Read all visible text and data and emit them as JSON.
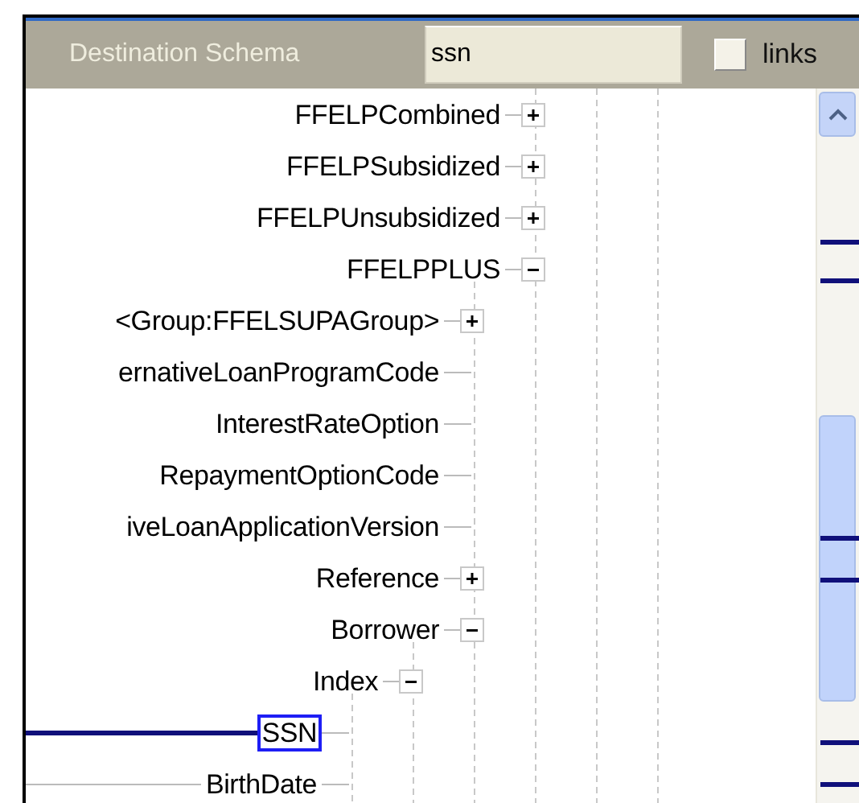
{
  "header": {
    "title": "Destination Schema",
    "search": {
      "value": "ssn"
    },
    "links_checkbox": {
      "label": "links",
      "checked": false
    }
  },
  "tree": [
    {
      "label": "FFELPCombined",
      "expanded": false,
      "selected": false,
      "linked": false
    },
    {
      "label": "FFELPSubsidized",
      "expanded": false,
      "selected": false,
      "linked": false
    },
    {
      "label": "FFELPUnsubsidized",
      "expanded": false,
      "selected": false,
      "linked": false
    },
    {
      "label": "FFELPPLUS",
      "expanded": true,
      "selected": false,
      "linked": false,
      "children": [
        {
          "label": "<Group:FFELSUPAGroup>",
          "expanded": false,
          "selected": false,
          "linked": false
        },
        {
          "label": "ernativeLoanProgramCode",
          "selected": false,
          "linked": false
        },
        {
          "label": "InterestRateOption",
          "selected": false,
          "linked": false
        },
        {
          "label": "RepaymentOptionCode",
          "selected": false,
          "linked": false
        },
        {
          "label": "iveLoanApplicationVersion",
          "selected": false,
          "linked": false
        },
        {
          "label": "Reference",
          "expanded": false,
          "selected": false,
          "linked": false
        },
        {
          "label": "Borrower",
          "expanded": true,
          "selected": false,
          "linked": false,
          "children": [
            {
              "label": "Index",
              "expanded": true,
              "selected": false,
              "linked": false,
              "children": [
                {
                  "label": "SSN",
                  "selected": true,
                  "linked": true
                },
                {
                  "label": "BirthDate",
                  "selected": false,
                  "linked": true
                }
              ]
            }
          ]
        }
      ]
    }
  ]
}
